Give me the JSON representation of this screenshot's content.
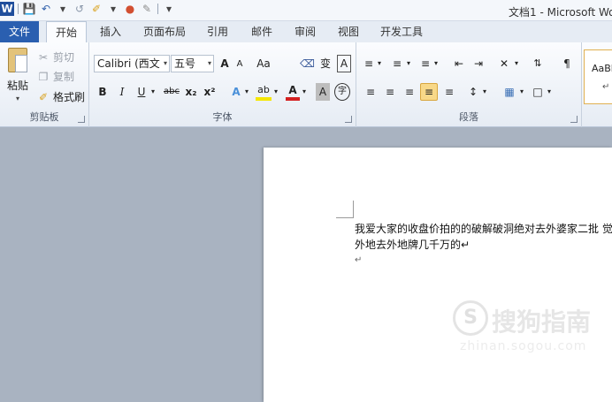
{
  "window": {
    "title": "文档1 - Microsoft Wo",
    "app_logo": "W"
  },
  "tabs": [
    {
      "label": "文件"
    },
    {
      "label": "开始"
    },
    {
      "label": "插入"
    },
    {
      "label": "页面布局"
    },
    {
      "label": "引用"
    },
    {
      "label": "邮件"
    },
    {
      "label": "审阅"
    },
    {
      "label": "视图"
    },
    {
      "label": "开发工具"
    }
  ],
  "clipboard": {
    "paste": "粘贴",
    "cut": "剪切",
    "copy": "复制",
    "format_painter": "格式刷",
    "group_label": "剪贴板"
  },
  "font": {
    "font_name": "Calibri (西文",
    "font_size": "五号",
    "group_label": "字体",
    "grow": "A",
    "shrink": "A",
    "case": "Aa",
    "bold": "B",
    "italic": "I",
    "underline": "U",
    "strike": "abc",
    "subscript": "x₂",
    "superscript": "x²",
    "text_effect": "A",
    "highlight": "ab",
    "font_color": "A",
    "char_shading": "A",
    "enclose": "字",
    "phonetic": "变",
    "border": "A"
  },
  "paragraph": {
    "group_label": "段落"
  },
  "styles": {
    "sample": "AaBl",
    "mark": "↵"
  },
  "document": {
    "line1": "我爱大家的收盘价拍的的破解破洞绝对去外婆家二批 觉",
    "line2": "外地去外地牌几千万的↵",
    "empty_para": "↵"
  },
  "watermark": {
    "logo": "S",
    "text": "搜狗指南",
    "url": "zhinan.sogou.com"
  },
  "colors": {
    "file_tab": "#2a5fb0",
    "highlight_yellow": "#f8d888",
    "font_red": "#d42020"
  }
}
